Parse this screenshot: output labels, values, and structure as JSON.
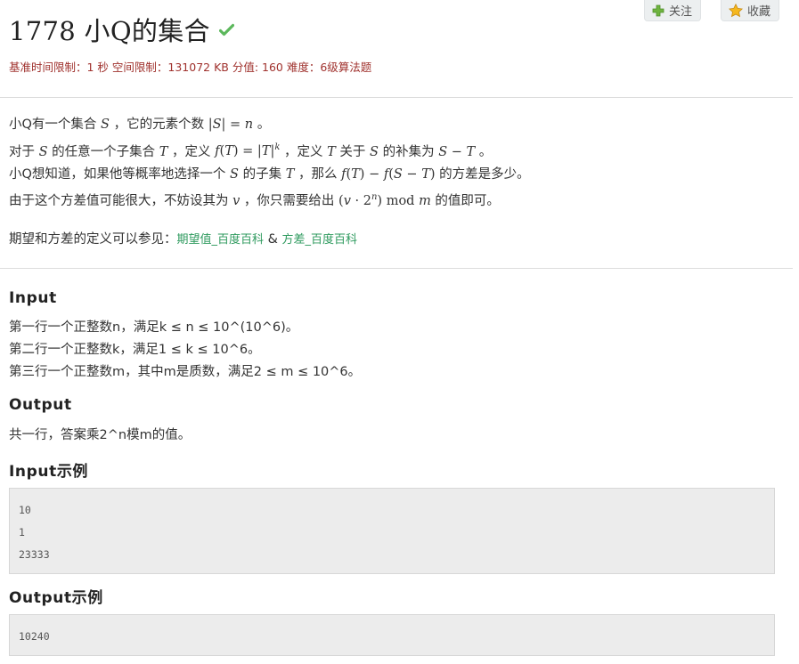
{
  "header": {
    "title": "1778 小Q的集合",
    "follow_label": "关注",
    "favorite_label": "收藏",
    "meta": "基准时间限制：1 秒 空间限制：131072 KB 分值: 160 难度：6级算法题",
    "colors": {
      "meta": "#a0322e",
      "check": "#5cb85c",
      "link": "#2e9a5e"
    }
  },
  "description": {
    "line1": {
      "a": "小Q有一个集合 ",
      "b": " ，它的元素个数 ",
      "c": " 。"
    },
    "line2": {
      "a": "对于 ",
      "b": " 的任意一个子集合 ",
      "c": " ，定义 ",
      "d": " ，定义 ",
      "e": " 关于 ",
      "f": " 的补集为 ",
      "g": " 。"
    },
    "line3": {
      "a": "小Q想知道，如果他等概率地选择一个 ",
      "b": " 的子集 ",
      "c": " ，那么 ",
      "d": " 的方差是多少。"
    },
    "line4": {
      "a": "由于这个方差值可能很大，不妨设其为 ",
      "b": " ，你只需要给出 ",
      "c": " 的值即可。"
    },
    "ref_prefix": "期望和方差的定义可以参见：",
    "ref_link1": "期望值_百度百科",
    "ref_amp": " & ",
    "ref_link2": "方差_百度百科"
  },
  "input_section": {
    "heading": "Input",
    "lines": [
      "第一行一个正整数n，满足k ≤ n ≤ 10^(10^6)。",
      "第二行一个正整数k，满足1 ≤ k ≤ 10^6。",
      "第三行一个正整数m，其中m是质数，满足2 ≤ m ≤ 10^6。"
    ]
  },
  "output_section": {
    "heading": "Output",
    "text": "共一行，答案乘2^n模m的值。"
  },
  "input_example": {
    "heading": "Input示例",
    "lines": [
      "10",
      "1",
      "23333"
    ]
  },
  "output_example": {
    "heading": "Output示例",
    "lines": [
      "10240"
    ]
  }
}
